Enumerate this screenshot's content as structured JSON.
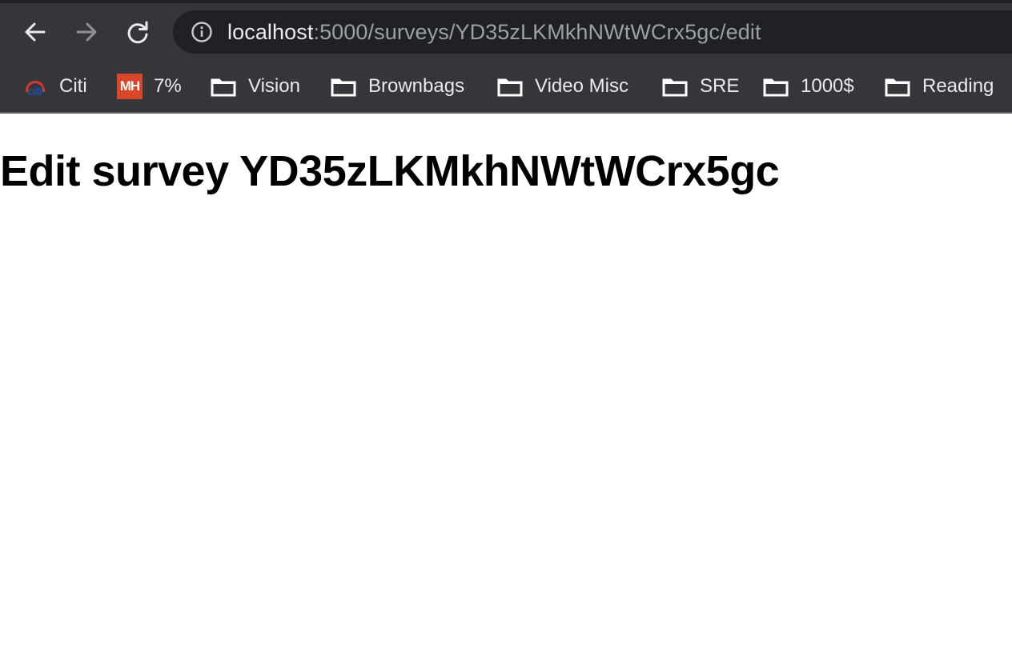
{
  "browser": {
    "url_host": "localhost",
    "url_path": ":5000/surveys/YD35zLKMkhNWtWCrx5gc/edit",
    "icons": {
      "back": "back-arrow-icon",
      "forward": "forward-arrow-icon",
      "reload": "reload-icon",
      "info": "info-icon"
    }
  },
  "bookmarks": [
    {
      "label": "Citi",
      "icon": "citi-logo-icon",
      "icon_text": "citi"
    },
    {
      "label": "7%",
      "icon": "mh-logo-icon",
      "icon_text": "MH"
    },
    {
      "label": "Vision",
      "icon": "folder-icon"
    },
    {
      "label": "Brownbags",
      "icon": "folder-icon"
    },
    {
      "label": "Video Misc",
      "icon": "folder-icon"
    },
    {
      "label": "SRE",
      "icon": "folder-icon"
    },
    {
      "label": "1000$",
      "icon": "folder-icon"
    },
    {
      "label": "Reading",
      "icon": "folder-icon"
    }
  ],
  "page": {
    "heading": "Edit survey YD35zLKMkhNWtWCrx5gc"
  },
  "colors": {
    "toolbar": "#35363a",
    "omnibox": "#202124",
    "text_light": "#e8eaed",
    "text_dim": "#9aa0a6",
    "mh_brand": "#d9472b"
  }
}
